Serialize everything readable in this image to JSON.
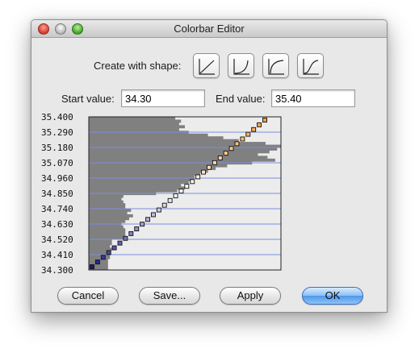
{
  "window": {
    "title": "Colorbar Editor"
  },
  "shapes": {
    "label": "Create with shape:",
    "buttons": [
      {
        "name": "linear"
      },
      {
        "name": "concave"
      },
      {
        "name": "convex"
      },
      {
        "name": "s-curve"
      }
    ]
  },
  "fields": {
    "start_label": "Start value:",
    "start_value": "34.30",
    "end_label": "End value:",
    "end_value": "35.40"
  },
  "chart_data": {
    "type": "bar",
    "description_units": "histogram of value distribution with colormap control points",
    "ytick_labels": [
      "35.400",
      "35.290",
      "35.180",
      "35.070",
      "34.960",
      "34.850",
      "34.740",
      "34.630",
      "34.520",
      "34.410",
      "34.300"
    ],
    "ylim": [
      34.3,
      35.4
    ],
    "histogram": [
      {
        "y": 35.39,
        "v": 0.45
      },
      {
        "y": 35.37,
        "v": 0.48
      },
      {
        "y": 35.35,
        "v": 0.47
      },
      {
        "y": 35.33,
        "v": 0.5
      },
      {
        "y": 35.31,
        "v": 0.47
      },
      {
        "y": 35.29,
        "v": 0.52
      },
      {
        "y": 35.27,
        "v": 0.62
      },
      {
        "y": 35.25,
        "v": 0.7
      },
      {
        "y": 35.23,
        "v": 0.78
      },
      {
        "y": 35.21,
        "v": 0.92
      },
      {
        "y": 35.19,
        "v": 1.0
      },
      {
        "y": 35.17,
        "v": 0.98
      },
      {
        "y": 35.15,
        "v": 0.94
      },
      {
        "y": 35.13,
        "v": 0.88
      },
      {
        "y": 35.11,
        "v": 0.93
      },
      {
        "y": 35.09,
        "v": 0.97
      },
      {
        "y": 35.07,
        "v": 0.85
      },
      {
        "y": 35.05,
        "v": 0.72
      },
      {
        "y": 35.03,
        "v": 0.66
      },
      {
        "y": 35.01,
        "v": 0.62
      },
      {
        "y": 34.99,
        "v": 0.58
      },
      {
        "y": 34.97,
        "v": 0.55
      },
      {
        "y": 34.95,
        "v": 0.55
      },
      {
        "y": 34.93,
        "v": 0.52
      },
      {
        "y": 34.91,
        "v": 0.48
      },
      {
        "y": 34.89,
        "v": 0.5
      },
      {
        "y": 34.87,
        "v": 0.46
      },
      {
        "y": 34.85,
        "v": 0.35
      },
      {
        "y": 34.83,
        "v": 0.18
      },
      {
        "y": 34.81,
        "v": 0.17
      },
      {
        "y": 34.79,
        "v": 0.18
      },
      {
        "y": 34.77,
        "v": 0.19
      },
      {
        "y": 34.75,
        "v": 0.19
      },
      {
        "y": 34.73,
        "v": 0.22
      },
      {
        "y": 34.71,
        "v": 0.2
      },
      {
        "y": 34.69,
        "v": 0.23
      },
      {
        "y": 34.67,
        "v": 0.21
      },
      {
        "y": 34.65,
        "v": 0.19
      },
      {
        "y": 34.63,
        "v": 0.17
      },
      {
        "y": 34.61,
        "v": 0.18
      },
      {
        "y": 34.59,
        "v": 0.19
      },
      {
        "y": 34.57,
        "v": 0.19
      },
      {
        "y": 34.55,
        "v": 0.19
      },
      {
        "y": 34.53,
        "v": 0.19
      },
      {
        "y": 34.51,
        "v": 0.12
      },
      {
        "y": 34.49,
        "v": 0.12
      },
      {
        "y": 34.47,
        "v": 0.11
      },
      {
        "y": 34.45,
        "v": 0.12
      },
      {
        "y": 34.43,
        "v": 0.11
      },
      {
        "y": 34.41,
        "v": 0.11
      },
      {
        "y": 34.39,
        "v": 0.11
      },
      {
        "y": 34.37,
        "v": 0.1
      },
      {
        "y": 34.35,
        "v": 0.1
      },
      {
        "y": 34.33,
        "v": 0.1
      },
      {
        "y": 34.31,
        "v": 0.1
      }
    ],
    "control_points": {
      "count": 32,
      "shape": "linear",
      "color_start": "#1a1a8c",
      "color_mid": "#ffffff",
      "color_end": "#f5a040"
    },
    "grid": true
  },
  "colors": {
    "bar": "#808080",
    "plot_bg": "#ececec",
    "grid": "#7a8ee0",
    "default_button": "#4f97ea"
  },
  "buttons": {
    "cancel": "Cancel",
    "save": "Save...",
    "apply": "Apply",
    "ok": "OK"
  }
}
